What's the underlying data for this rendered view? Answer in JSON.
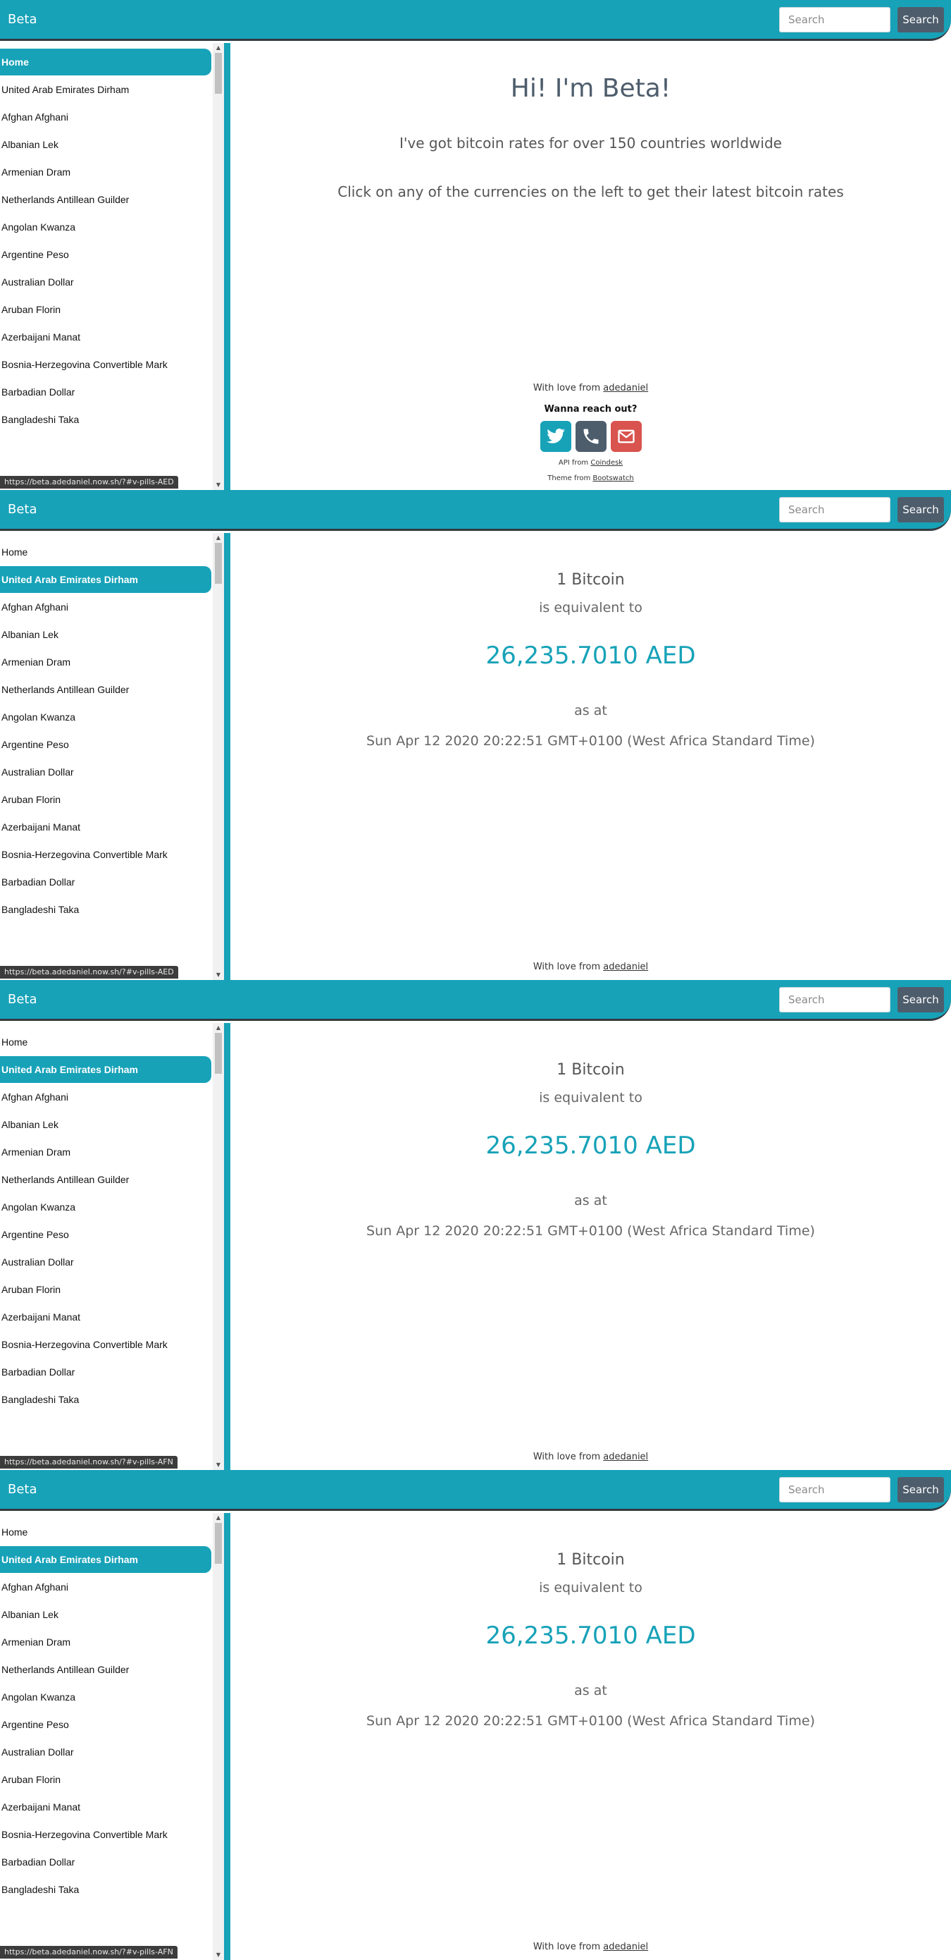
{
  "app": {
    "brand": "Beta",
    "search_placeholder": "Search",
    "search_button": "Search"
  },
  "sidebar": {
    "items": [
      "Home",
      "United Arab Emirates Dirham",
      "Afghan Afghani",
      "Albanian Lek",
      "Armenian Dram",
      "Netherlands Antillean Guilder",
      "Angolan Kwanza",
      "Argentine Peso",
      "Australian Dollar",
      "Aruban Florin",
      "Azerbaijani Manat",
      "Bosnia-Herzegovina Convertible Mark",
      "Barbadian Dollar",
      "Bangladeshi Taka"
    ]
  },
  "welcome": {
    "title": "Hi! I'm Beta!",
    "line1": "I've got bitcoin rates for over 150 countries worldwide",
    "line2": "Click on any of the currencies on the left to get their latest bitcoin rates"
  },
  "rate": {
    "amount": "1 Bitcoin",
    "equivalent": "is equivalent to",
    "value": "26,235.7010 AED",
    "as_at": "as at",
    "timestamp": "Sun Apr 12 2020 20:22:51 GMT+0100 (West Africa Standard Time)"
  },
  "footer": {
    "love_prefix": "With love from",
    "author": "adedaniel",
    "reach_out": "Wanna reach out?",
    "api_prefix": "API from",
    "api_source": "Coindesk",
    "theme_prefix": "Theme from",
    "theme_source": "Bootswatch"
  },
  "social": [
    {
      "icon": "twitter-icon",
      "color": "#17a2b8"
    },
    {
      "icon": "phone-icon",
      "color": "#4e5d6c"
    },
    {
      "icon": "email-icon",
      "color": "#d9534f"
    }
  ],
  "status_urls": [
    "https://beta.adedaniel.now.sh/?#v-pills-AED",
    "https://beta.adedaniel.now.sh/?#v-pills-AED",
    "https://beta.adedaniel.now.sh/?#v-pills-AFN",
    "https://beta.adedaniel.now.sh/?#v-pills-AFN"
  ],
  "colors": {
    "accent": "#17a2b8",
    "dark": "#4e5d6c",
    "danger": "#d9534f"
  }
}
